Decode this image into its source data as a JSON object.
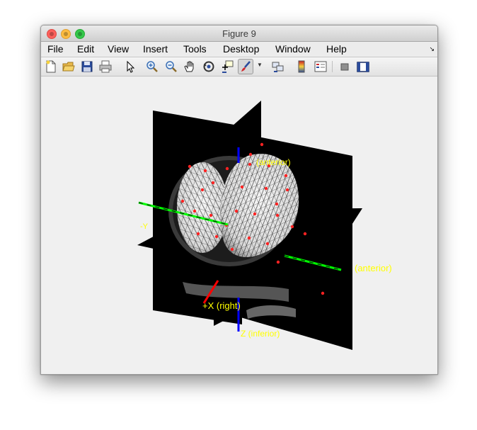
{
  "window": {
    "title": "Figure 9"
  },
  "menu": {
    "items": [
      "File",
      "Edit",
      "View",
      "Insert",
      "Tools",
      "Desktop",
      "Window",
      "Help"
    ]
  },
  "toolbar": {
    "buttons": [
      "new-figure-icon",
      "open-file-icon",
      "save-icon",
      "print-icon",
      "edit-plot-pointer-icon",
      "zoom-in-icon",
      "zoom-out-icon",
      "pan-hand-icon",
      "rotate-3d-icon",
      "data-cursor-icon",
      "brush-icon",
      "brush-dropdown-icon",
      "link-plot-icon",
      "insert-colorbar-icon",
      "insert-legend-icon",
      "hide-plot-tools-icon",
      "show-plot-tools-icon"
    ]
  },
  "plot": {
    "labels": {
      "anterior_top": "(anterior)",
      "anterior_right": "(anterior)",
      "x_right": "+X (right)",
      "z_inferior": "Z (inferior)",
      "y_left_fragment": "-Y"
    },
    "colors": {
      "axis_x": "#ff0000",
      "axis_y": "#00ff00",
      "axis_z": "#0000ff",
      "labels": "#ffff00",
      "electrodes": "#ff0000",
      "slice": "#000000"
    }
  }
}
